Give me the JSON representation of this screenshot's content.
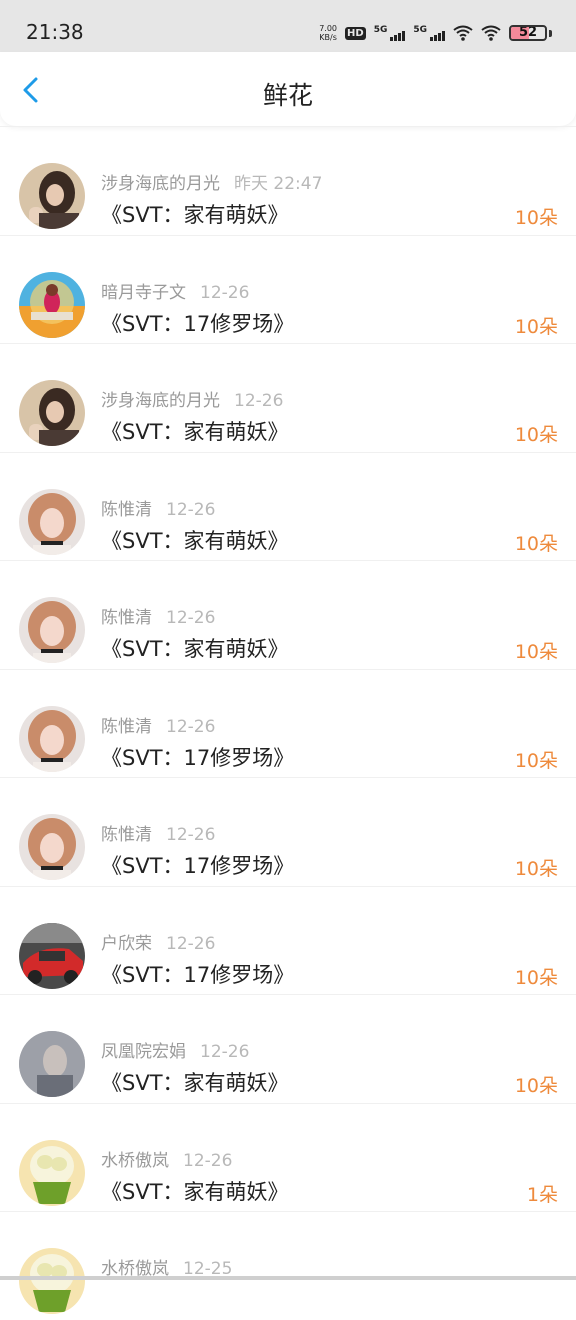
{
  "status": {
    "time": "21:38",
    "net_speed_value": "7.00",
    "net_speed_unit": "KB/s",
    "hd_label": "HD",
    "signal1_label": "5G",
    "signal2_label": "5G",
    "battery_level": "52",
    "battery_percent": 52
  },
  "header": {
    "title": "鲜花",
    "back_icon": "chevron-left-icon",
    "accent_color": "#1e9be8"
  },
  "colors": {
    "amount": "#ee8a3c",
    "name": "#9a9a9a",
    "title": "#222222"
  },
  "items": [
    {
      "name": "涉身海底的月光",
      "date": "昨天 22:47",
      "book": "《SVT：家有萌妖》",
      "amount": "10朵"
    },
    {
      "name": "暗月寺子文",
      "date": "12-26",
      "book": "《SVT：17修罗场》",
      "amount": "10朵"
    },
    {
      "name": "涉身海底的月光",
      "date": "12-26",
      "book": "《SVT：家有萌妖》",
      "amount": "10朵"
    },
    {
      "name": "陈惟清",
      "date": "12-26",
      "book": "《SVT：家有萌妖》",
      "amount": "10朵"
    },
    {
      "name": "陈惟清",
      "date": "12-26",
      "book": "《SVT：家有萌妖》",
      "amount": "10朵"
    },
    {
      "name": "陈惟清",
      "date": "12-26",
      "book": "《SVT：17修罗场》",
      "amount": "10朵"
    },
    {
      "name": "陈惟清",
      "date": "12-26",
      "book": "《SVT：17修罗场》",
      "amount": "10朵"
    },
    {
      "name": "户欣荣",
      "date": "12-26",
      "book": "《SVT：17修罗场》",
      "amount": "10朵"
    },
    {
      "name": "凤凰院宏娟",
      "date": "12-26",
      "book": "《SVT：家有萌妖》",
      "amount": "10朵"
    },
    {
      "name": "水桥傲岚",
      "date": "12-26",
      "book": "《SVT：家有萌妖》",
      "amount": "1朵"
    },
    {
      "name": "水桥傲岚",
      "date": "12-25",
      "book": "",
      "amount": ""
    }
  ]
}
